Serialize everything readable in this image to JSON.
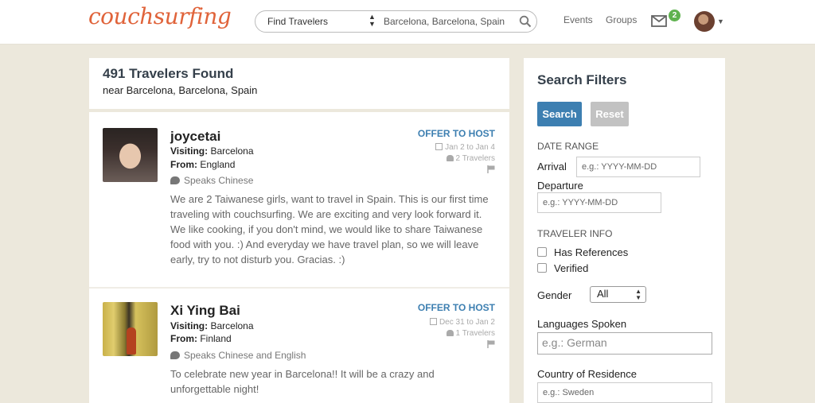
{
  "header": {
    "logo": "couchsurfing",
    "search_type": "Find Travelers",
    "search_location": "Barcelona, Barcelona, Spain",
    "nav_events": "Events",
    "nav_groups": "Groups",
    "mail_count": "2"
  },
  "results": {
    "title": "491 Travelers Found",
    "subtitle": "near Barcelona, Barcelona, Spain",
    "items": [
      {
        "name": "joycetai",
        "visiting_label": "Visiting:",
        "visiting": "Barcelona",
        "from_label": "From:",
        "from": "England",
        "speaks": "Speaks Chinese",
        "offer": "OFFER TO HOST",
        "dates": "Jan 2 to Jan 4",
        "travelers": "2 Travelers",
        "description": "We are 2 Taiwanese girls, want to travel in Spain. This is our first time traveling with couchsurfing. We are exciting and very look forward it. We like cooking, if you don't mind, we would like to share Taiwanese food with you. :) And everyday we have travel plan, so we will leave early, try to not disturb you. Gracias. :)"
      },
      {
        "name": "Xi Ying Bai",
        "visiting_label": "Visiting:",
        "visiting": "Barcelona",
        "from_label": "From:",
        "from": "Finland",
        "speaks": "Speaks Chinese and English",
        "offer": "OFFER TO HOST",
        "dates": "Dec 31 to Jan 2",
        "travelers": "1 Travelers",
        "description": "To celebrate new year in Barcelona!! It will be a crazy and unforgettable night!"
      }
    ]
  },
  "filters": {
    "title": "Search Filters",
    "search_btn": "Search",
    "reset_btn": "Reset",
    "date_range": "DATE RANGE",
    "arrival": "Arrival",
    "arrival_placeholder": "e.g.: YYYY-MM-DD",
    "departure": "Departure",
    "departure_placeholder": "e.g.: YYYY-MM-DD",
    "traveler_info": "TRAVELER INFO",
    "has_references": "Has References",
    "verified": "Verified",
    "gender": "Gender",
    "gender_value": "All",
    "languages": "Languages Spoken",
    "languages_placeholder": "e.g.: German",
    "country": "Country of Residence",
    "country_placeholder": "e.g.: Sweden"
  },
  "colors": {
    "brand": "#e0633a",
    "accent": "#3d7fb1",
    "badge": "#5fb24f",
    "page_bg": "#ece8dc"
  }
}
